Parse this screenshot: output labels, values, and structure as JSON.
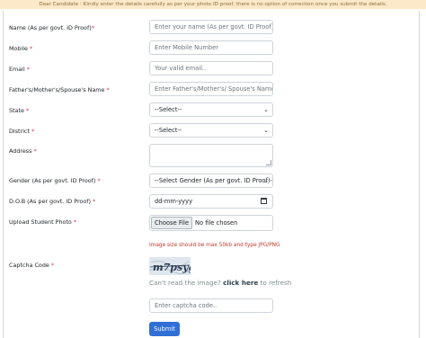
{
  "notice": "Dear Candidate : Kindly enter the details carefully as per your photo ID proof, there is no option of correction once you submit the details.",
  "fields": {
    "name": {
      "label": "Name (As per govt. ID Proof)",
      "placeholder": "Enter your name  (As per govt. ID Proof)"
    },
    "mobile": {
      "label": "Mobile",
      "placeholder": "Enter Mobile Number"
    },
    "email": {
      "label": "Email",
      "placeholder": "Your valid email.."
    },
    "guardian": {
      "label": "Father's/Mother's/Spouse's Name",
      "placeholder": "Enter Father's/Mother's/ Spouse's Name"
    },
    "state": {
      "label": "State",
      "selected": "--Select--"
    },
    "district": {
      "label": "District",
      "selected": "--Select--"
    },
    "address": {
      "label": "Address",
      "value": ""
    },
    "gender": {
      "label": "Gender (As per govt. ID Proof)",
      "selected": "--Select Gender (As per govt. ID Proof)--"
    },
    "dob": {
      "label": "D.O.B (As per govt. ID Proof)",
      "placeholder": "dd-mm-yyyy"
    },
    "photo": {
      "label": "Upload Student Photo",
      "button": "Choose File",
      "status": "No file chosen"
    },
    "captcha": {
      "label": "Captcha Code",
      "placeholder": "Enter captcha code.."
    }
  },
  "required_mark": "*",
  "photo_hint": "Image size should be max 50kb and type JPG/PNG",
  "captcha_image_text": "m7psyg",
  "refresh": {
    "prefix": "Can't read the image?",
    "link": "click here",
    "suffix": "to refresh"
  },
  "submit_label": "Submit",
  "colors": {
    "notice_bg": "#fce9c9",
    "primary": "#2f6fd6",
    "required": "#dc3545",
    "hint": "#c0392b"
  },
  "icons": {
    "select": "chevron-down-icon",
    "date": "calendar-icon"
  }
}
